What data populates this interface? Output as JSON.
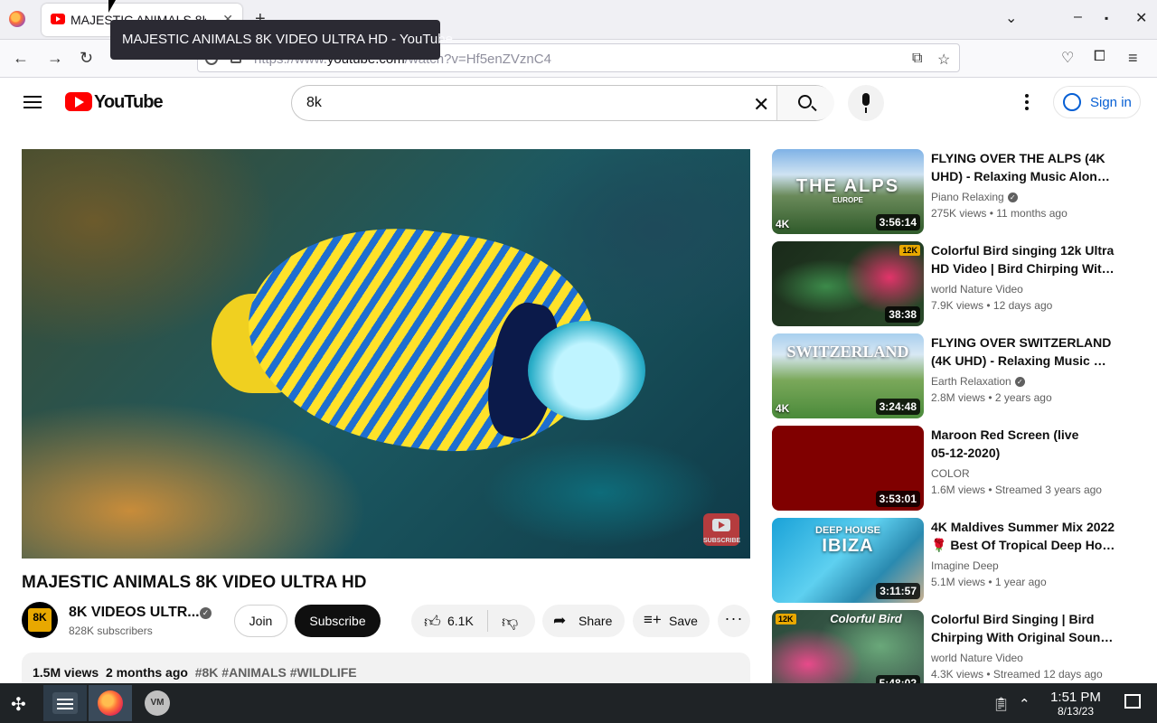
{
  "browser": {
    "tab_title": "MAJESTIC ANIMALS 8K VIDEO ULTRA HD - YouTube",
    "tab_title_visible": "MAJESTIC ANIMALS 8K",
    "tooltip": "MAJESTIC ANIMALS 8K VIDEO ULTRA HD - YouTube",
    "url_prefix": "https://www.",
    "url_host": "youtube.com",
    "url_path": "/watch?v=Hf5enZVznC4"
  },
  "header": {
    "logo_text": "YouTube",
    "search_value": "8k",
    "signin_label": "Sign in"
  },
  "video": {
    "title": "MAJESTIC ANIMALS 8K VIDEO ULTRA HD",
    "channel_name": "8K VIDEOS ULTR...",
    "channel_avatar_text": "8K",
    "subscribers": "828K subscribers",
    "join_label": "Join",
    "subscribe_label": "Subscribe",
    "likes": "6.1K",
    "share_label": "Share",
    "save_label": "Save",
    "watermark_text": "SUBSCRIBE",
    "views": "1.5M views",
    "age": "2 months ago",
    "tags": "#8K #ANIMALS #WILDLIFE"
  },
  "recommendations": [
    {
      "title_line1": "FLYING OVER THE ALPS (4K",
      "title_line2": "UHD) - Relaxing Music Along...",
      "channel": "Piano Relaxing",
      "verified": true,
      "views": "275K views",
      "age": "11 months ago",
      "duration": "3:56:14",
      "thumb_text": "THE ALPS",
      "thumb_sub": "EUROPE",
      "left_badge": "4K"
    },
    {
      "title_line1": "Colorful Bird singing 12k Ultra",
      "title_line2": "HD Video | Bird Chirping With...",
      "channel": "world Nature Video",
      "verified": false,
      "views": "7.9K views",
      "age": "12 days ago",
      "duration": "38:38",
      "corner_badge": "12K"
    },
    {
      "title_line1": "FLYING OVER SWITZERLAND",
      "title_line2": "(4K UHD) - Relaxing Music Wit...",
      "channel": "Earth Relaxation",
      "verified": true,
      "views": "2.8M views",
      "age": "2 years ago",
      "duration": "3:24:48",
      "thumb_text": "SWITZERLAND",
      "left_badge": "4K"
    },
    {
      "title_line1": "Maroon Red Screen (live",
      "title_line2": "05-12-2020)",
      "channel": "COLOR",
      "verified": false,
      "views": "1.6M views",
      "age": "Streamed 3 years ago",
      "duration": "3:53:01"
    },
    {
      "title_line1": "4K Maldives Summer Mix 2022",
      "title_line2": "🌹 Best Of Tropical Deep Hous...",
      "channel": "Imagine Deep",
      "verified": false,
      "views": "5.1M views",
      "age": "1 year ago",
      "duration": "3:11:57",
      "thumb_text": "IBIZA",
      "thumb_sub": "DEEP HOUSE"
    },
    {
      "title_line1": "Colorful Bird Singing | Bird",
      "title_line2": "Chirping With Original Sound |...",
      "channel": "world Nature Video",
      "verified": false,
      "views": "4.3K views",
      "age": "Streamed 12 days ago",
      "duration": "5:48:02",
      "thumb_text": "Colorful Bird",
      "corner_badge": "12K"
    }
  ],
  "taskbar": {
    "time": "1:51 PM",
    "date": "8/13/23",
    "vm_label": "VM"
  },
  "colors": {
    "brand_red": "#ff0000",
    "link_blue": "#065fd4",
    "maroon": "#800000"
  }
}
